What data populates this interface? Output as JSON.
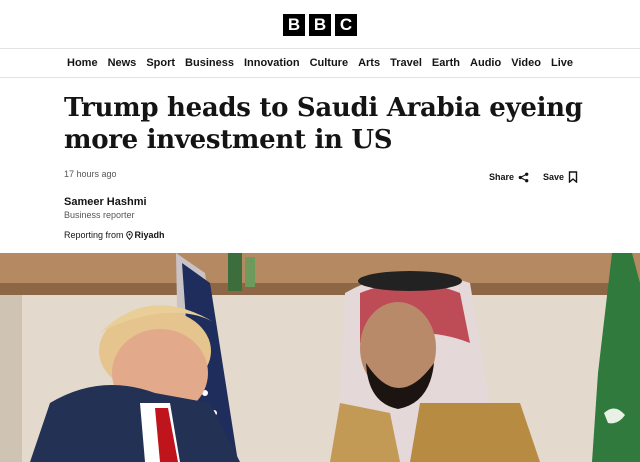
{
  "brand": {
    "letters": [
      "B",
      "B",
      "C"
    ]
  },
  "nav": {
    "items": [
      "Home",
      "News",
      "Sport",
      "Business",
      "Innovation",
      "Culture",
      "Arts",
      "Travel",
      "Earth",
      "Audio",
      "Video",
      "Live"
    ]
  },
  "article": {
    "headline": "Trump heads to Saudi Arabia eyeing more investment in US",
    "timestamp": "17 hours ago",
    "share_label": "Share",
    "save_label": "Save",
    "author_name": "Sameer Hashmi",
    "author_role": "Business reporter",
    "reporting_prefix": "Reporting from",
    "reporting_location": "Riyadh"
  },
  "icons": {
    "share": "share-icon",
    "save": "bookmark-icon",
    "location": "location-pin-icon"
  },
  "colors": {
    "text": "#141414",
    "secondary_text": "#545658",
    "logo_block": "#000000",
    "divider": "#e3e3e3"
  }
}
